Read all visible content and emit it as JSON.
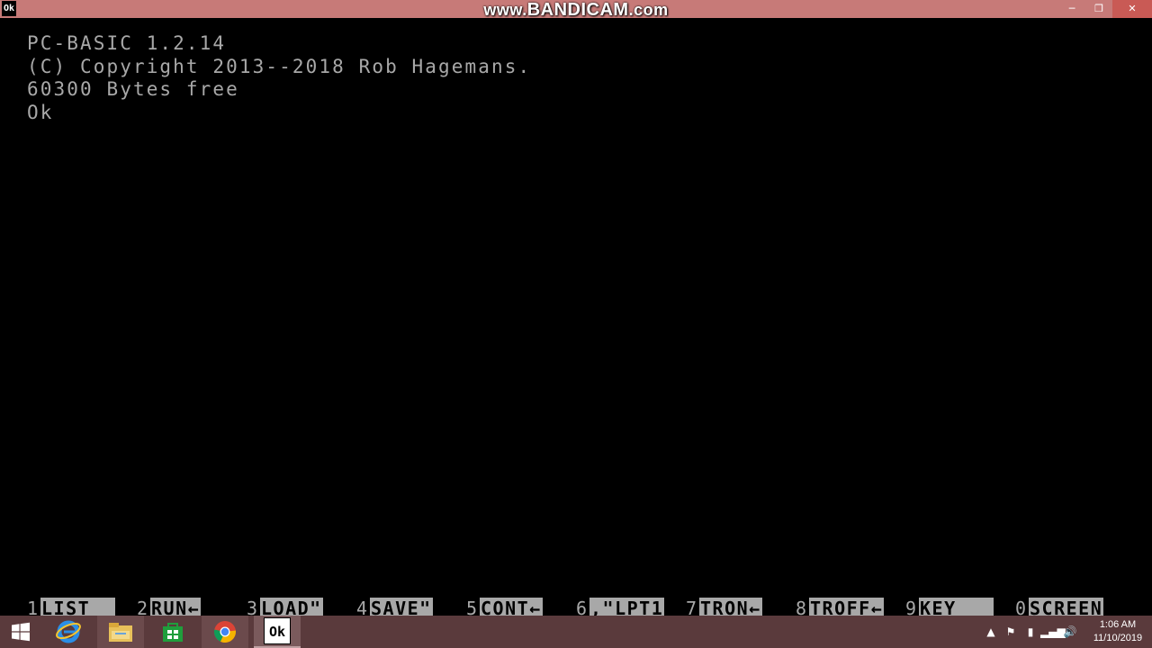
{
  "titlebar": {
    "icon_text": "Ok",
    "watermark_prefix": "www.",
    "watermark_brand": "BANDICAM",
    "watermark_suffix": ".com",
    "minimize": "─",
    "restore": "❐",
    "close": "✕"
  },
  "terminal": {
    "lines": [
      "PC-BASIC 1.2.14",
      "(C) Copyright 2013--2018 Rob Hagemans.",
      "60300 Bytes free",
      "Ok"
    ]
  },
  "function_keys": [
    {
      "num": "1",
      "label": "LIST  "
    },
    {
      "num": "2",
      "label": "RUN←"
    },
    {
      "num": "3",
      "label": "LOAD\""
    },
    {
      "num": "4",
      "label": "SAVE\""
    },
    {
      "num": "5",
      "label": "CONT←"
    },
    {
      "num": "6",
      "label": ",\"LPT1"
    },
    {
      "num": "7",
      "label": "TRON←"
    },
    {
      "num": "8",
      "label": "TROFF←"
    },
    {
      "num": "9",
      "label": "KEY   "
    },
    {
      "num": "0",
      "label": "SCREEN"
    }
  ],
  "taskbar": {
    "items": [
      {
        "icon": "windows-start-icon"
      },
      {
        "icon": "internet-explorer-icon"
      },
      {
        "icon": "file-explorer-icon"
      },
      {
        "icon": "store-icon"
      },
      {
        "icon": "chrome-icon"
      },
      {
        "icon": "pc-basic-icon",
        "text": "Ok"
      }
    ],
    "clock_time": "1:06 AM",
    "clock_date": "11/10/2019"
  },
  "colors": {
    "titlebar": "#c77a78",
    "terminal_text": "#a8a8a8",
    "taskbar": "#5a3a3c"
  }
}
